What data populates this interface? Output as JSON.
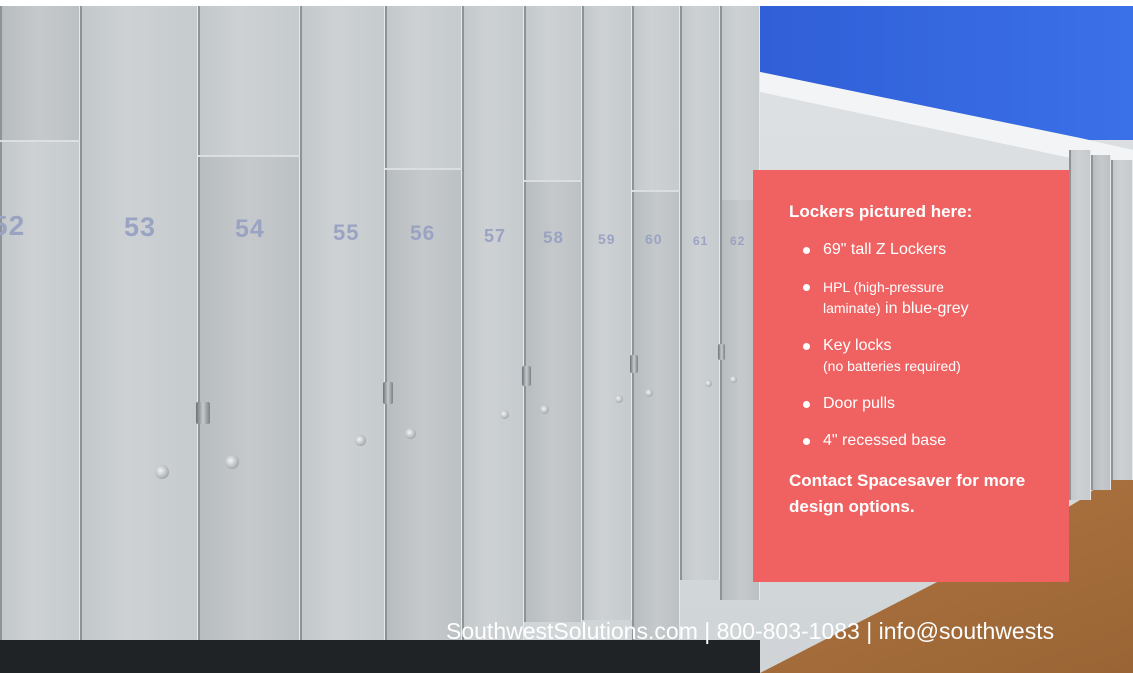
{
  "locker_numbers": [
    "52",
    "53",
    "54",
    "55",
    "56",
    "57",
    "58",
    "59",
    "60",
    "61",
    "62"
  ],
  "panel": {
    "title": "Lockers pictured here:",
    "items": [
      {
        "main": "69\" tall Z Lockers",
        "sub": ""
      },
      {
        "main_small": "HPL (high-pressure",
        "line2_small": "laminate)",
        "line2_main": " in blue-grey"
      },
      {
        "main": "Key locks",
        "sub": "(no batteries required)"
      },
      {
        "main": "Door pulls",
        "sub": ""
      },
      {
        "main": "4\" recessed base",
        "sub": ""
      }
    ],
    "contact": "Contact Spacesaver for more design options."
  },
  "footer": "SouthwestSolutions.com | 800-803-1083 | info@southwests",
  "colors": {
    "panel": "#f06262",
    "wall_band": "#2c56cf",
    "locker": "#c6cbce",
    "floor": "#b67c46"
  }
}
